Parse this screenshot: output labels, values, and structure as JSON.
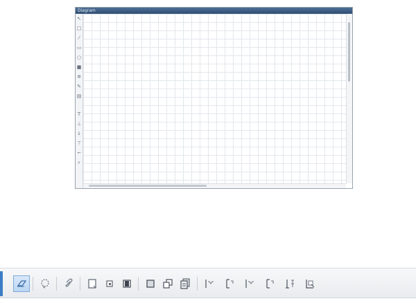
{
  "window": {
    "title": "Diagram"
  },
  "palette_tools": [
    {
      "icon": "pointer-icon"
    },
    {
      "icon": "rectangle-icon"
    },
    {
      "icon": "pencil-icon"
    },
    {
      "icon": "ellipse-icon"
    },
    {
      "icon": "circle-icon"
    },
    {
      "icon": "filled-square-icon"
    },
    {
      "icon": "gear-icon"
    },
    {
      "icon": "pen-icon"
    },
    {
      "icon": "stack-icon"
    },
    {
      "icon": "text-icon"
    },
    {
      "icon": "line-icon"
    },
    {
      "icon": "arrow-icon"
    },
    {
      "icon": "connector-icon"
    },
    {
      "icon": "link-icon"
    },
    {
      "icon": "zoom-icon"
    }
  ],
  "toolbar": {
    "accent": "#3c7ec6",
    "buttons": [
      {
        "icon": "eraser-icon",
        "active": true
      },
      {
        "icon": "lasso-icon"
      },
      {
        "icon": "paperclip-icon"
      },
      {
        "icon": "page-icon"
      },
      {
        "icon": "page-small-icon"
      },
      {
        "icon": "page-fill-icon"
      },
      {
        "icon": "square-icon"
      },
      {
        "icon": "copy-icon"
      },
      {
        "icon": "pages-icon"
      },
      {
        "icon": "align-left-icon"
      },
      {
        "icon": "align-top-icon"
      },
      {
        "icon": "align-center-icon"
      },
      {
        "icon": "align-middle-icon"
      },
      {
        "icon": "distribute-icon"
      },
      {
        "icon": "align-corner-icon"
      }
    ]
  }
}
